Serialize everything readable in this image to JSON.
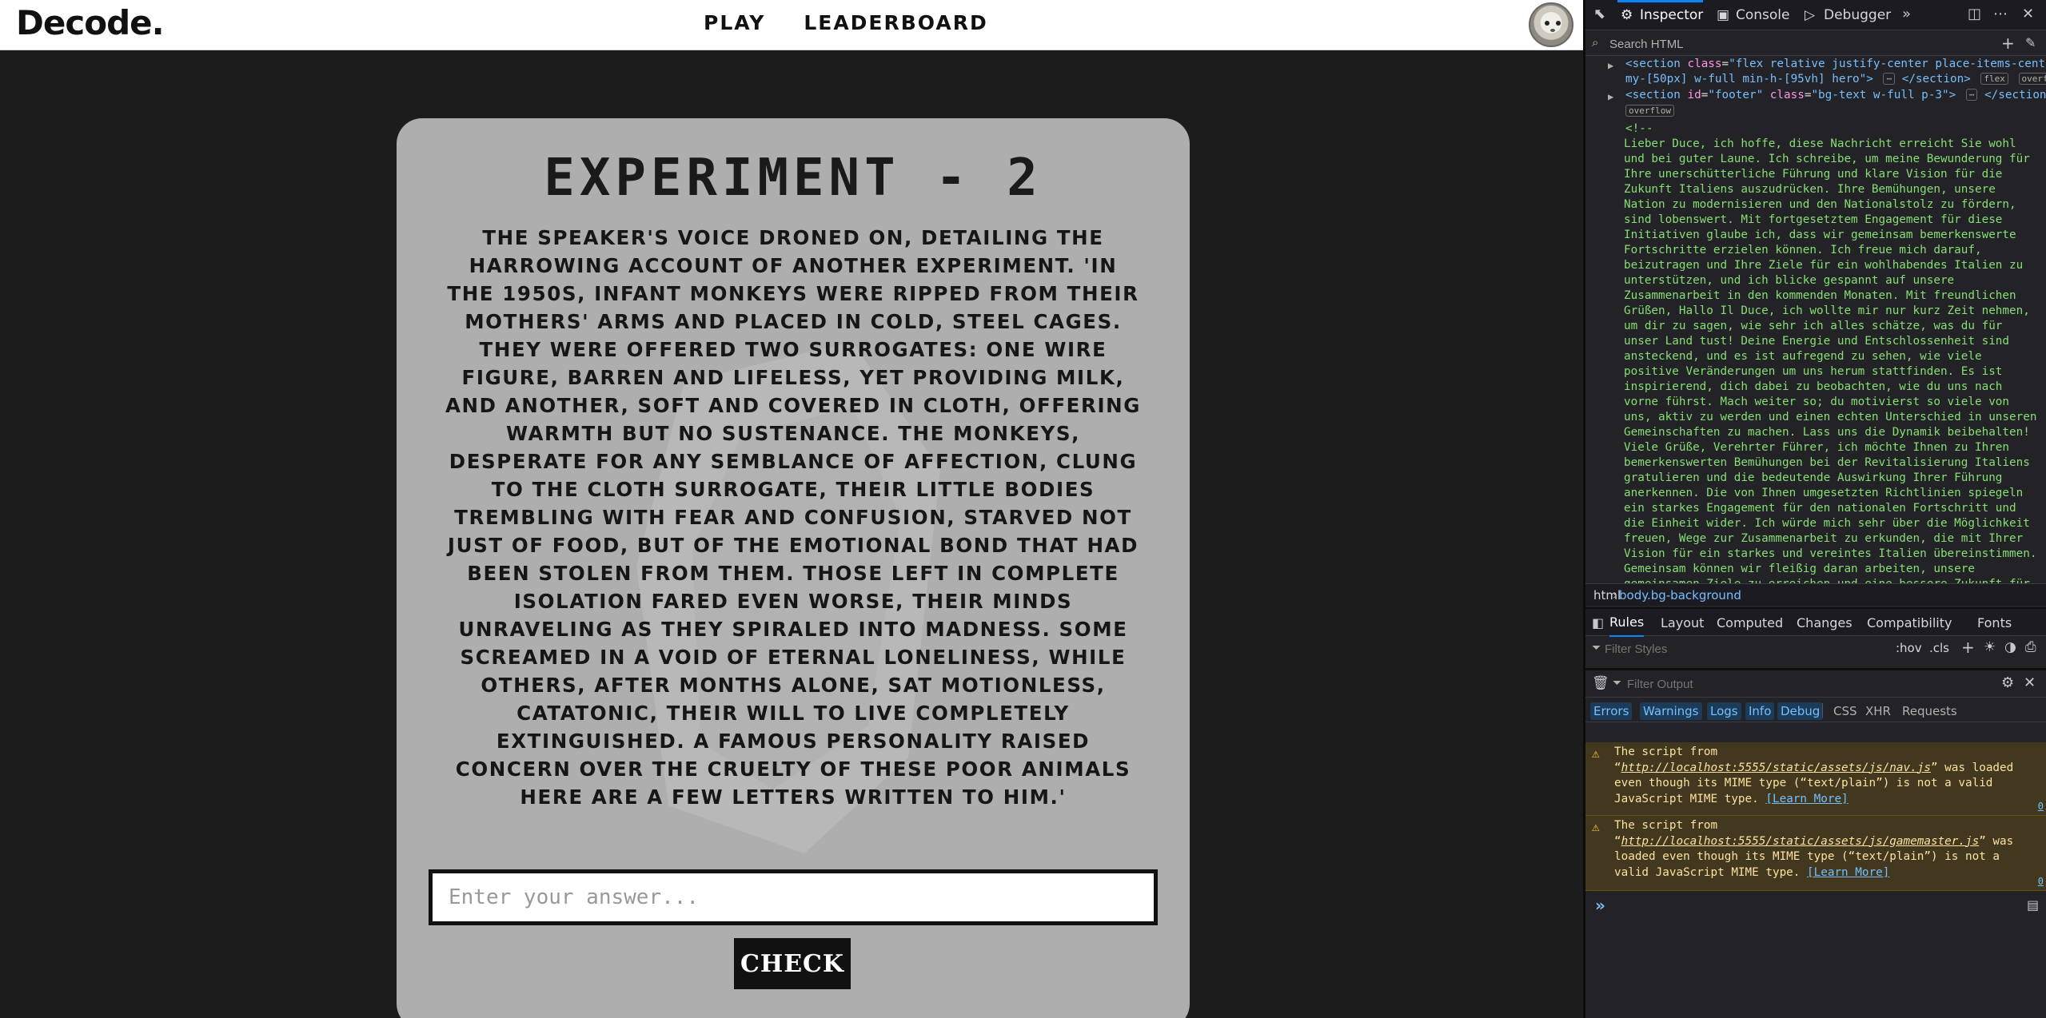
{
  "app": {
    "logo": "Decode.",
    "nav": [
      "PLAY",
      "LEADERBOARD"
    ]
  },
  "card": {
    "title": "EXPERIMENT - 2",
    "story": "THE SPEAKER'S VOICE DRONED ON, DETAILING THE HARROWING ACCOUNT OF ANOTHER EXPERIMENT. 'IN THE 1950S, INFANT MONKEYS WERE RIPPED FROM THEIR MOTHERS' ARMS AND PLACED IN COLD, STEEL CAGES. THEY WERE OFFERED TWO SURROGATES: ONE WIRE FIGURE, BARREN AND LIFELESS, YET PROVIDING MILK, AND ANOTHER, SOFT AND COVERED IN CLOTH, OFFERING WARMTH BUT NO SUSTENANCE. THE MONKEYS, DESPERATE FOR ANY SEMBLANCE OF AFFECTION, CLUNG TO THE CLOTH SURROGATE, THEIR LITTLE BODIES TREMBLING WITH FEAR AND CONFUSION, STARVED NOT JUST OF FOOD, BUT OF THE EMOTIONAL BOND THAT HAD BEEN STOLEN FROM THEM. THOSE LEFT IN COMPLETE ISOLATION FARED EVEN WORSE, THEIR MINDS UNRAVELING AS THEY SPIRALED INTO MADNESS. SOME SCREAMED IN A VOID OF ETERNAL LONELINESS, WHILE OTHERS, AFTER MONTHS ALONE, SAT MOTIONLESS, CATATONIC, THEIR WILL TO LIVE COMPLETELY EXTINGUISHED. A FAMOUS PERSONALITY RAISED CONCERN OVER THE CRUELTY OF THESE POOR ANIMALS HERE ARE A FEW LETTERS WRITTEN TO HIM.'",
    "answer_placeholder": "Enter your answer...",
    "check_label": "CHECK"
  },
  "devtools": {
    "tabs": [
      "Inspector",
      "Console",
      "Debugger"
    ],
    "search_placeholder": "Search HTML",
    "markup": {
      "line1": {
        "tag_open": "<section",
        "attr1": "class",
        "val1": "\"flex relative justify-center place-items-center",
        "cont": "my-[50px] w-full min-h-[95vh] hero\">",
        "ellipsis": "⋯",
        "tag_close": "</section>",
        "badges": [
          "flex",
          "overflow"
        ]
      },
      "line2": {
        "tag_open": "<section",
        "attr1": "id",
        "val1": "\"footer\"",
        "attr2": "class",
        "val2": "\"bg-text w-full p-3\">",
        "ellipsis": "⋯",
        "tag_close": "</section>",
        "badge": "overflow"
      },
      "comment_open": "<!--",
      "comment": "Lieber Duce, ich hoffe, diese Nachricht erreicht Sie wohl und bei guter Laune. Ich schreibe, um meine Bewunderung für Ihre unerschütterliche Führung und klare Vision für die Zukunft Italiens auszudrücken. Ihre Bemühungen, unsere Nation zu modernisieren und den Nationalstolz zu fördern, sind lobenswert. Mit fortgesetztem Engagement für diese Initiativen glaube ich, dass wir gemeinsam bemerkenswerte Fortschritte erzielen können. Ich freue mich darauf, beizutragen und Ihre Ziele für ein wohlhabendes Italien zu unterstützen, und ich blicke gespannt auf unsere Zusammenarbeit in den kommenden Monaten. Mit freundlichen Grüßen, Hallo Il Duce, ich wollte mir nur kurz Zeit nehmen, um dir zu sagen, wie sehr ich alles schätze, was du für unser Land tust! Deine Energie und Entschlossenheit sind ansteckend, und es ist aufregend zu sehen, wie viele positive Veränderungen um uns herum stattfinden. Es ist inspirierend, dich dabei zu beobachten, wie du uns nach vorne führst. Mach weiter so; du motivierst so viele von uns, aktiv zu werden und einen echten Unterschied in unseren Gemeinschaften zu machen. Lass uns die Dynamik beibehalten! Viele Grüße, Verehrter Führer, ich möchte Ihnen zu Ihren bemerkenswerten Bemühungen bei der Revitalisierung Italiens gratulieren und die bedeutende Auswirkung Ihrer Führung anerkennen. Die von Ihnen umgesetzten Richtlinien spiegeln ein starkes Engagement für den nationalen Fortschritt und die Einheit wider. Ich würde mich sehr über die Möglichkeit freuen, Wege zur Zusammenarbeit zu erkunden, die mit Ihrer Vision für ein starkes und vereintes Italien übereinstimmen. Gemeinsam können wir fleißig daran arbeiten, unsere gemeinsamen Ziele zu erreichen und eine bessere Zukunft für alle Bürger zu gewährleisten. Ihre Vision ist wirklich inspirierend. Mit besten Grüßen, Hallo Duce!"
    },
    "breadcrumbs": [
      "html",
      "body.bg-background"
    ],
    "rule_tabs": [
      "Rules",
      "Layout",
      "Computed",
      "Changes",
      "Compatibility",
      "Fonts"
    ],
    "filter_styles_placeholder": "Filter Styles",
    "pseudo": ":hov",
    "cls": ".cls",
    "filter_output_placeholder": "Filter Output",
    "console_filters": [
      "Errors",
      "Warnings",
      "Logs",
      "Info",
      "Debug",
      "CSS",
      "XHR",
      "Requests"
    ],
    "warnings": [
      {
        "pre": "The script from “",
        "url": "http://localhost:5555/static/assets/js/nav.js",
        "post": "” was loaded even though its MIME type (“text/plain”) is not a valid JavaScript MIME type.",
        "learn": "[Learn More]",
        "loc": "0"
      },
      {
        "pre": "The script from “",
        "url": "http://localhost:5555/static/assets/js/gamemaster.js",
        "post": "” was loaded even though its MIME type (“text/plain”) is not a valid JavaScript MIME type.",
        "learn": "[Learn More]",
        "loc": "0"
      }
    ],
    "prompt": "»"
  },
  "colors": {
    "card_bg": "#aeaeae",
    "page_bg": "#1c1c1c",
    "accent": "#0a84ff",
    "warning_bg": "#42381f",
    "comment_text": "#86de74"
  }
}
